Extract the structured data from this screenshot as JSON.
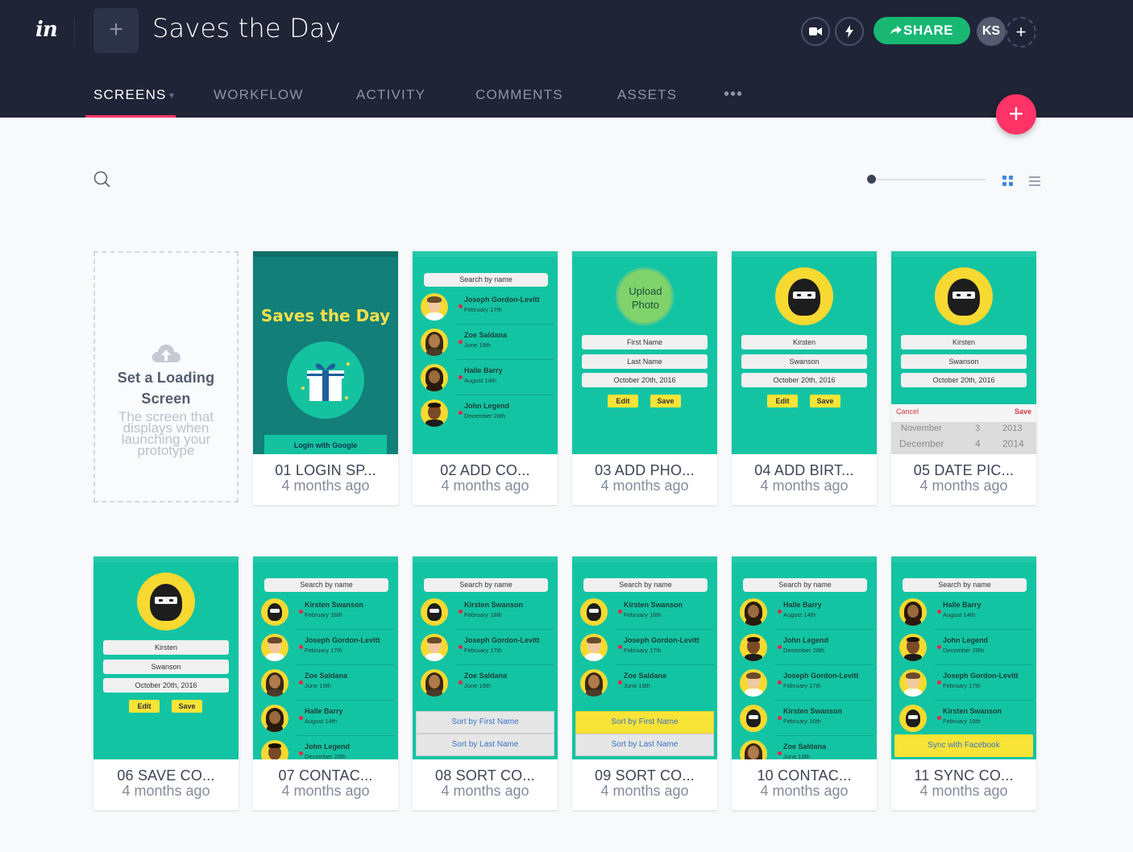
{
  "app": {
    "logo": "in",
    "project_title": "Saves the Day",
    "add_project_label": "+",
    "share_label": "SHARE",
    "avatar_initials": "KS",
    "add_member_label": "+",
    "fab_label": "+"
  },
  "tabs": [
    {
      "label": "SCREENS",
      "active": true
    },
    {
      "label": "WORKFLOW"
    },
    {
      "label": "ACTIVITY"
    },
    {
      "label": "COMMENTS"
    },
    {
      "label": "ASSETS"
    }
  ],
  "tab_more": "•••",
  "toolbar": {
    "zoom_level": 0.0,
    "view_mode": "grid"
  },
  "loading_card": {
    "title": "Set a Loading Screen",
    "description": "The screen that displays when launching your prototype"
  },
  "thumbs": {
    "search_placeholder": "Search by name",
    "login_title": "Saves the Day",
    "login_button": "Login with Google",
    "upload_photo": "Upload Photo",
    "first_name": "First Name",
    "last_name": "Last Name",
    "kirsten": "Kirsten",
    "swanson": "Swanson",
    "date_value": "October 20th, 2016",
    "edit": "Edit",
    "save": "Save",
    "cancel": "Cancel",
    "picker_row1": [
      "November",
      "3",
      "2013"
    ],
    "picker_row2": [
      "December",
      "4",
      "2014"
    ],
    "sort_first": "Sort by First Name",
    "sort_last": "Sort by Last Name",
    "sync_facebook": "Sync with Facebook"
  },
  "contacts": {
    "jgl": {
      "name": "Joseph Gordon-Levitt",
      "date": "February 17th"
    },
    "zoe": {
      "name": "Zoe Saldana",
      "date": "June 19th"
    },
    "halle": {
      "name": "Halle Barry",
      "date": "August 14th"
    },
    "john": {
      "name": "John Legend",
      "date": "December 28th"
    },
    "kirsten": {
      "name": "Kirsten Swanson",
      "date": "February 16th"
    }
  },
  "screens": [
    {
      "name": "01 LOGIN SP...",
      "time": "4 months ago"
    },
    {
      "name": "02 ADD CO...",
      "time": "4 months ago"
    },
    {
      "name": "03 ADD PHO...",
      "time": "4 months ago"
    },
    {
      "name": "04 ADD BIRT...",
      "time": "4 months ago"
    },
    {
      "name": "05 DATE PIC...",
      "time": "4 months ago"
    },
    {
      "name": "06 SAVE CO...",
      "time": "4 months ago"
    },
    {
      "name": "07 CONTAC...",
      "time": "4 months ago"
    },
    {
      "name": "08 SORT CO...",
      "time": "4 months ago"
    },
    {
      "name": "09 SORT CO...",
      "time": "4 months ago"
    },
    {
      "name": "10 CONTAC...",
      "time": "4 months ago"
    },
    {
      "name": "11 SYNC CO...",
      "time": "4 months ago"
    }
  ],
  "colors": {
    "header_bg": "#1f2436",
    "accent_pink": "#ff3366",
    "share_green": "#18b873",
    "thumb_teal": "#13c4a3",
    "thumb_yellow": "#f7d931"
  }
}
